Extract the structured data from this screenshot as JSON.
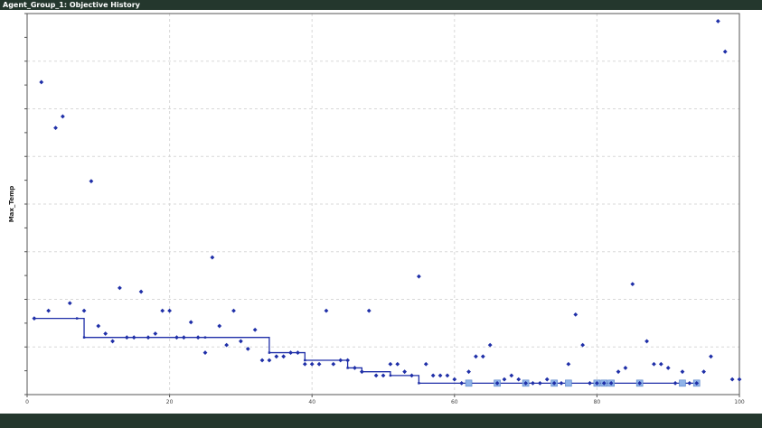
{
  "window": {
    "title": "Agent_Group_1: Objective History"
  },
  "colors": {
    "titlebar": "#24372d",
    "series": "#1f2fa8",
    "best_marker": "#8fb3e8",
    "grid": "#d8d8d8"
  },
  "chart_data": {
    "type": "scatter",
    "title": "",
    "xlabel": "",
    "ylabel": "Max_Temp",
    "xlim": [
      0,
      100
    ],
    "ylim": [
      0,
      100
    ],
    "grid": true,
    "x_ticks": [
      0,
      20,
      40,
      60,
      80,
      100
    ],
    "series": [
      {
        "kind": "points",
        "x": [
          1,
          2,
          3,
          4,
          5,
          6,
          8,
          9,
          10,
          11,
          12,
          13,
          14,
          15,
          16,
          17,
          18,
          19,
          20,
          21,
          22,
          23,
          24,
          25,
          26,
          27,
          28,
          29,
          30,
          31,
          32,
          33,
          34,
          35,
          36,
          37,
          38,
          39,
          40,
          41,
          42,
          43,
          44,
          45,
          46,
          47,
          48,
          49,
          50,
          51,
          52,
          53,
          54,
          55,
          56,
          57,
          58,
          59,
          60,
          61,
          62,
          63,
          64,
          65,
          66,
          67,
          68,
          69,
          70,
          71,
          72,
          73,
          74,
          75,
          76,
          77,
          78,
          79,
          80,
          81,
          82,
          83,
          84,
          85,
          86,
          87,
          88,
          89,
          90,
          91,
          92,
          93,
          94,
          95,
          96,
          97,
          98,
          99,
          100
        ],
        "y": [
          20,
          82,
          22,
          70,
          73,
          24,
          22,
          56,
          18,
          16,
          14,
          28,
          15,
          15,
          27,
          15,
          16,
          22,
          22,
          15,
          15,
          19,
          15,
          11,
          36,
          18,
          13,
          22,
          14,
          12,
          17,
          9,
          9,
          10,
          10,
          11,
          11,
          8,
          8,
          8,
          22,
          8,
          9,
          9,
          7,
          6,
          22,
          5,
          5,
          8,
          8,
          6,
          5,
          31,
          8,
          5,
          5,
          5,
          4,
          3,
          6,
          10,
          10,
          13,
          3,
          4,
          5,
          4,
          3,
          3,
          3,
          4,
          3,
          3,
          8,
          21,
          13,
          3,
          3,
          3,
          3,
          6,
          7,
          29,
          3,
          14,
          8,
          8,
          7,
          3,
          6,
          3,
          3,
          6,
          10,
          98,
          90,
          4,
          4
        ]
      },
      {
        "kind": "best-so-far-step",
        "x": [
          1,
          7,
          8,
          25,
          34,
          39,
          45,
          47,
          51,
          55,
          62,
          66,
          70,
          74,
          80,
          82,
          86,
          92,
          94
        ],
        "y": [
          20,
          20,
          15,
          15,
          11,
          9,
          7,
          6,
          5,
          3,
          3,
          3,
          3,
          3,
          3,
          3,
          3,
          3,
          3
        ]
      }
    ],
    "best_points": {
      "x": [
        62,
        66,
        70,
        74,
        76,
        80,
        81,
        82,
        86,
        92,
        94
      ],
      "y": [
        3,
        3,
        3,
        3,
        3,
        3,
        3,
        3,
        3,
        3,
        3
      ]
    }
  }
}
